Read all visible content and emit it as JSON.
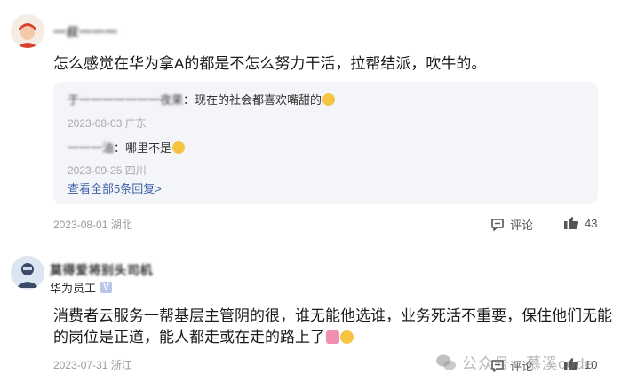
{
  "comments": [
    {
      "username": "一叔一一一",
      "text": "怎么感觉在华为拿A的都是不怎么努力干活，拉帮结派，吹牛的。",
      "replies": [
        {
          "author": "于一一一一一一一夜果",
          "text": "：现在的社会都喜欢嘴甜的",
          "date": "2023-08-03",
          "location": "广东"
        },
        {
          "author": "一一一油",
          "text": "：哪里不是",
          "date": "2023-09-25",
          "location": "四川"
        }
      ],
      "view_all": "查看全部5条回复>",
      "date": "2023-08-01",
      "location": "湖北",
      "reply_label": "评论",
      "likes": "43"
    },
    {
      "username": "莫得爱将别头司机",
      "user_tag": "华为员工",
      "text": "消费者云服务一帮基层主管阴的很，谁无能他选谁，业务死活不重要，保住他们无能的岗位是正道，能人都走或在走的路上了",
      "date": "2023-07-31",
      "location": "浙江",
      "reply_label": "评论",
      "likes": "10"
    }
  ],
  "watermark": "公众号 · 慕溪code",
  "colors": {
    "link": "#3b5fa8",
    "meta": "#999999",
    "reply_bg": "#f4f5f9"
  }
}
